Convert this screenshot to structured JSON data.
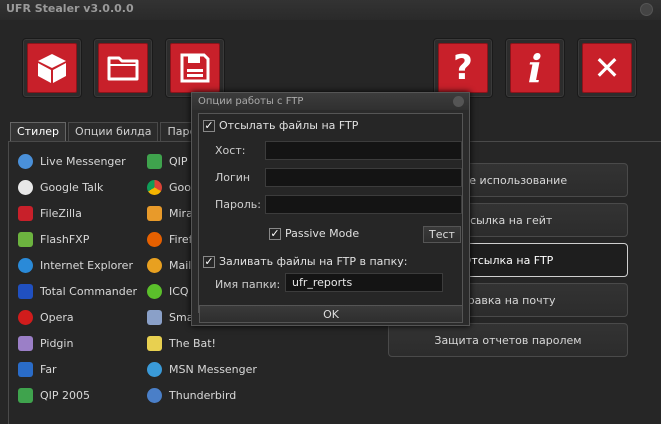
{
  "window": {
    "title": "UFR Stealer v3.0.0.0"
  },
  "toolbar": {
    "build_icon": "cube-icon",
    "open_icon": "folder-icon",
    "save_icon": "floppy-icon",
    "help_glyph": "?",
    "info_glyph": "i",
    "close_glyph": "✕",
    "accent_color": "#c8202a"
  },
  "tabs": [
    "Стилер",
    "Опции билда",
    "Парсер от"
  ],
  "apps_col1": [
    {
      "label": "Live Messenger",
      "icon": "live-messenger-icon"
    },
    {
      "label": "Google Talk",
      "icon": "google-talk-icon"
    },
    {
      "label": "FileZilla",
      "icon": "filezilla-icon"
    },
    {
      "label": "FlashFXP",
      "icon": "flashfxp-icon"
    },
    {
      "label": "Internet Explorer",
      "icon": "internet-explorer-icon"
    },
    {
      "label": "Total Commander",
      "icon": "total-commander-icon"
    },
    {
      "label": "Opera",
      "icon": "opera-icon"
    },
    {
      "label": "Pidgin",
      "icon": "pidgin-icon"
    },
    {
      "label": "Far",
      "icon": "far-icon"
    },
    {
      "label": "QIP 2005",
      "icon": "qip-icon"
    }
  ],
  "apps_col2": [
    {
      "label": "QIP",
      "icon": "qip-infium-icon"
    },
    {
      "label": "Goo",
      "icon": "chrome-icon"
    },
    {
      "label": "Mira",
      "icon": "miranda-icon"
    },
    {
      "label": "Firef",
      "icon": "firefox-icon"
    },
    {
      "label": "Mail.",
      "icon": "mail-icon"
    },
    {
      "label": "ICQ",
      "icon": "icq-icon"
    },
    {
      "label": "Sma",
      "icon": "smartftp-icon"
    },
    {
      "label": "The Bat!",
      "icon": "the-bat-icon"
    },
    {
      "label": "MSN Messenger",
      "icon": "msn-icon"
    },
    {
      "label": "Thunderbird",
      "icon": "thunderbird-icon"
    }
  ],
  "right_buttons": [
    "ьное использование",
    "тсылка на гейт",
    "Отсылка на FTP",
    "правка на почту",
    "Защита отчетов паролем"
  ],
  "dialog": {
    "title": "Опции работы с FTP",
    "send_files": "Отсылать файлы на FTP",
    "host_label": "Хост:",
    "login_label": "Логин",
    "password_label": "Пароль:",
    "host_value": "",
    "login_value": "",
    "password_value": "",
    "passive_mode": "Passive Mode",
    "test_button": "Тест",
    "upload_folder": "Заливать файлы на FTP в папку:",
    "folder_label": "Имя папки:",
    "folder_value": "ufr_reports",
    "ok_button": "OK",
    "check_mark": "✓"
  }
}
